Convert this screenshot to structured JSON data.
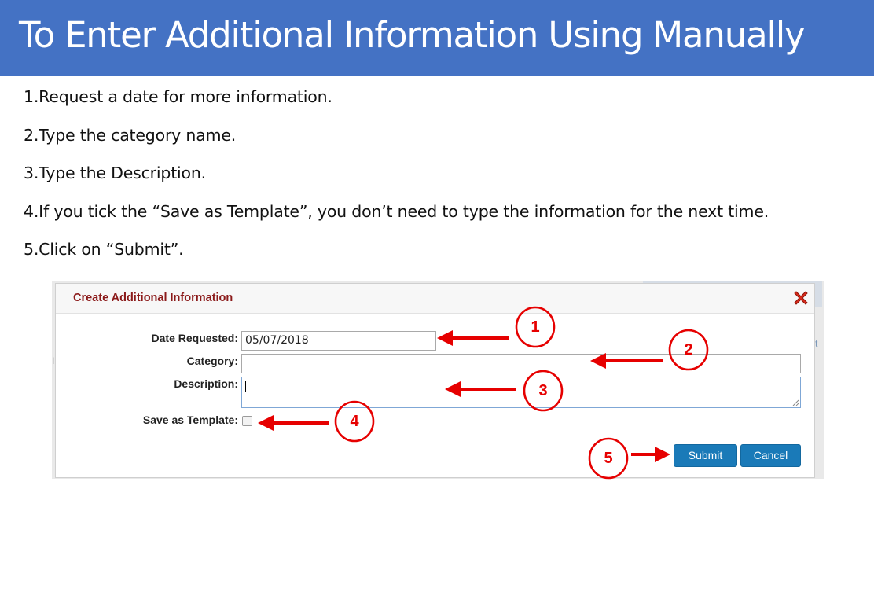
{
  "slide": {
    "title": "To Enter Additional Information Using Manually",
    "steps": [
      "1.Request a date for more information.",
      "2.Type the category name.",
      "3.Type the Description.",
      "4.If you tick the “Save as Template”, you don’t need to type the information for the next time.",
      "5.Click on “Submit”."
    ],
    "colors": {
      "banner": "#4472c4",
      "annotation": "#e60000"
    }
  },
  "dialog": {
    "title": "Create Additional Information",
    "close_icon": "close-x-icon",
    "fields": {
      "date_label": "Date Requested:",
      "date_value": "05/07/2018",
      "category_label": "Category:",
      "category_value": "",
      "description_label": "Description:",
      "description_value": "",
      "template_label": "Save as Template:",
      "template_checked": false
    },
    "buttons": {
      "submit": "Submit",
      "cancel": "Cancel"
    },
    "colors": {
      "title": "#8b1a1a",
      "button": "#1a7ab8"
    }
  },
  "annotations": {
    "markers": [
      "1",
      "2",
      "3",
      "4",
      "5"
    ],
    "arrow_icon": "red-arrow-icon"
  },
  "background_fragments": {
    "right_letter": "t",
    "left_mark": "I"
  }
}
